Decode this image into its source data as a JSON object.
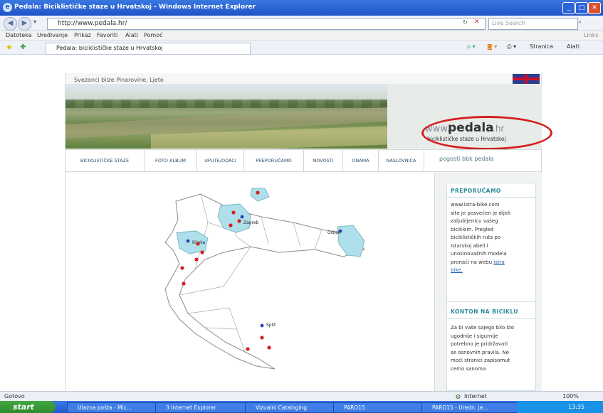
{
  "window": {
    "title": "Pedala: Biciklističke staze u Hrvatskoj - Windows Internet Explorer"
  },
  "address_bar": {
    "url": "http://www.pedala.hr/",
    "search_placeholder": "Live Search"
  },
  "menu": [
    "Datoteka",
    "Uređivanje",
    "Prikaz",
    "Favoriti",
    "Alati",
    "Pomoć"
  ],
  "menu_right": "Links",
  "favorites_tab": "Pedala: biciklističke staze u Hrvatskoj",
  "toolbar_right": [
    "Stranica",
    "Alati"
  ],
  "page": {
    "breadcrumb": "Svezanci blize Pinarovine, Ljeto",
    "logo": {
      "www": "www.",
      "name": "pedala",
      "tld": ".hr",
      "tagline": "biciklističke staze u Hrvatskoj"
    },
    "nav": [
      "BICIKLISTIČKE STAZE",
      "FOTO ALBUM",
      "UPUTE/ODACI",
      "PREPORUČAMO",
      "NOVOSTI",
      "ONAMA",
      "NASLOVNICA"
    ],
    "nav_search": "pogosti bbk pedala",
    "map_labels": [
      "Zagreb",
      "Rijeka",
      "Osijek",
      "Split"
    ],
    "sidebar": {
      "heading1": "PREPORUČAMO",
      "text1_before_link": "www.istra-bike.com\nsite je posvećen je dijeli\nzaljubljenicu vašeg\nbiciklom. Pregled\nbiciklističkih ruta po\nIstarskoj abeli i\nunosinovažnih modela\npronaći na webu ",
      "text1_link": "istra\nbike.",
      "heading2": "KONTON NA BICIKLU",
      "text2": "Za bi vaše sajego bilo što\nugodnije i sigurnije\npotrebno je pridržavati\nse osnovnih pravila. Ne\nmoći stranici zapisomut\ncemo sanoma"
    }
  },
  "status": {
    "left": "Gotovo",
    "zone": "Internet",
    "zoom": "100%"
  },
  "taskbar": {
    "start": "start",
    "tasks": [
      "Ulazna pošta - Mic...",
      "3 Internet Explorer",
      "Vizualni Cataloging",
      "PARO15",
      "PARO15 - Uredn. je..."
    ],
    "clock": "13:35"
  }
}
